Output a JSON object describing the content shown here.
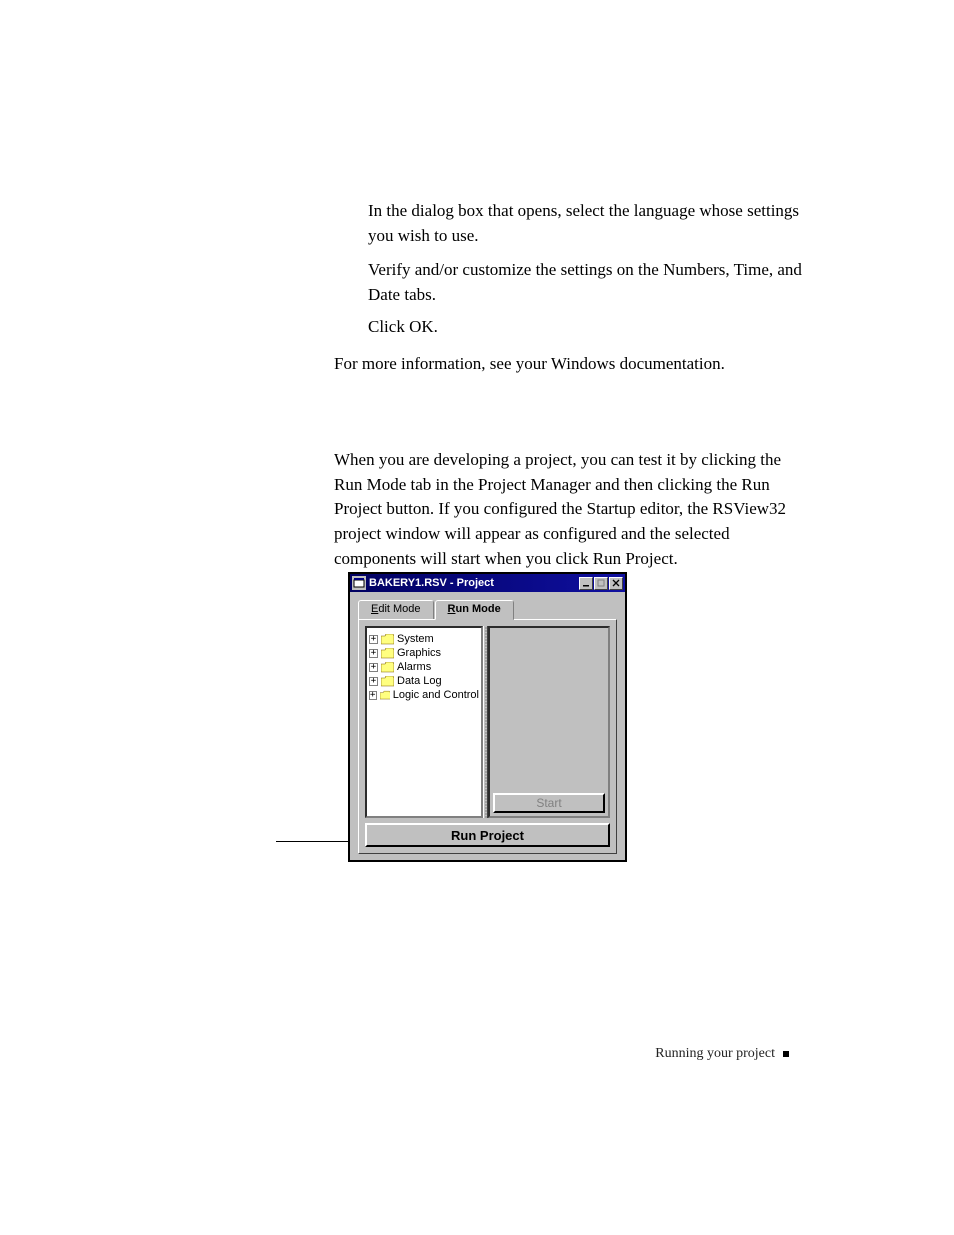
{
  "body": {
    "p1": "In the dialog box that opens, select the language whose settings you wish to use.",
    "p2": "Verify and/or customize the settings on the Numbers, Time, and Date tabs.",
    "p3": "Click OK.",
    "p4": "For more information, see your Windows documentation.",
    "p5": "When you are developing a project, you can test it by clicking the Run Mode tab in the Project Manager and then clicking the Run Project button. If you configured the Startup editor, the RSView32 project window will appear as configured and the selected components will start when you click Run Project."
  },
  "window": {
    "title": "BAKERY1.RSV - Project",
    "tabs": {
      "edit_prefix": "E",
      "edit_rest": "dit Mode",
      "run_prefix": "R",
      "run_rest": "un Mode"
    },
    "tree": [
      "System",
      "Graphics",
      "Alarms",
      "Data Log",
      "Logic and Control"
    ],
    "start_label": "Start",
    "run_label": "Run Project"
  },
  "footer": {
    "text": "Running your project"
  }
}
